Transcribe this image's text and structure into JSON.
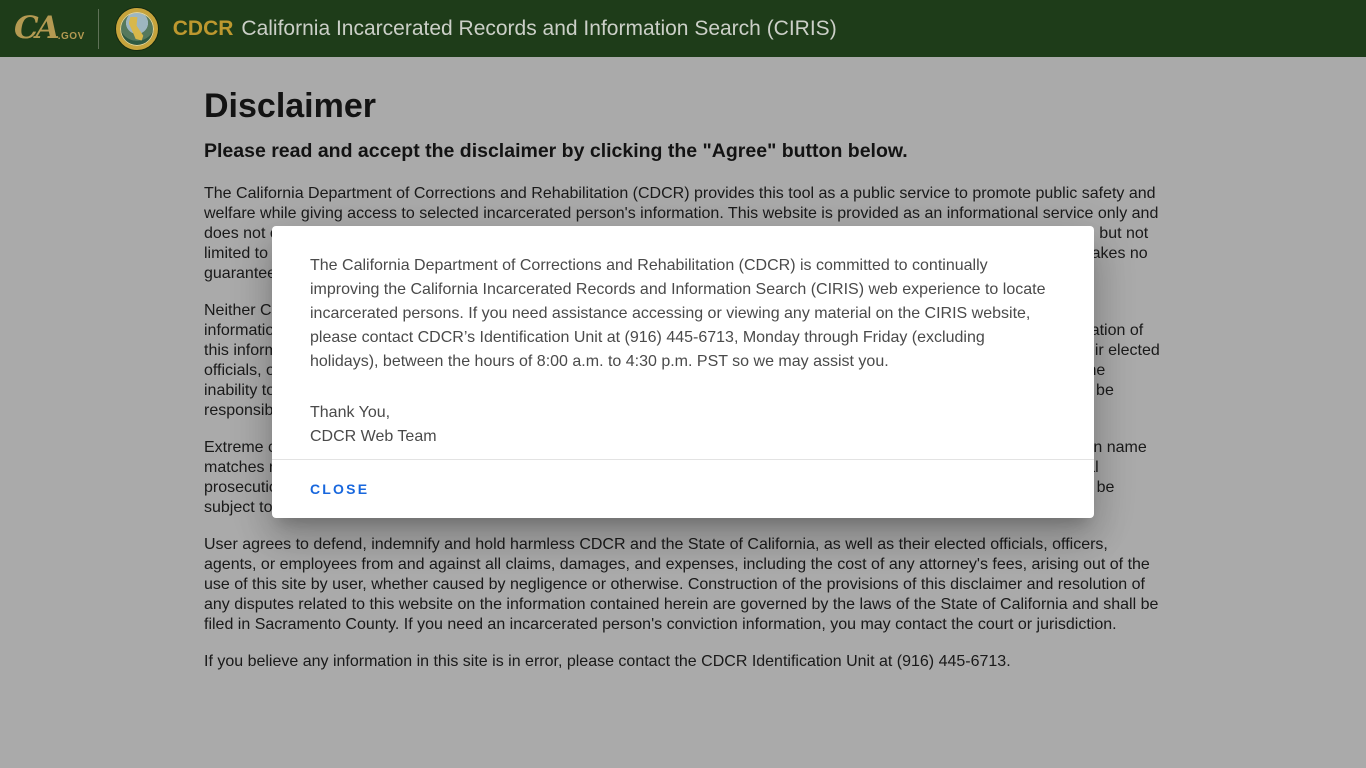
{
  "header": {
    "ca_gov_logo": "CA",
    "ca_gov_suffix": ".GOV",
    "brand_acronym": "CDCR",
    "title": "California Incarcerated Records and Information Search (CIRIS)",
    "colors": {
      "header_bg": "#1e3c19",
      "brand_gold": "#bd982f",
      "title_color": "#cbcfc7"
    }
  },
  "page": {
    "heading": "Disclaimer",
    "subheading": "Please read and accept the disclaimer by clicking the \"Agree\" button below.",
    "paragraphs": [
      "The California Department of Corrections and Rehabilitation (CDCR) provides this tool as a public service to promote public safety and welfare while giving access to selected incarcerated person's information. This website is provided as an informational service only and does not constitute, and should not be relied upon as, an official record of CDCR. It may contain errors or omissions, including but not limited to an incarcerated person's current location, commitment county, admitted date, and scheduled release date. CDCR makes no guarantee as to the accuracy or completeness of the information contained in this website.",
      "Neither CDCR nor the State of California assumes any responsibility or legal liability for the accuracy or completeness of the information contained herein, and the user shall assume full responsibility for any use of this information. Secondary dissemination of this information, by or on consent of the user, may subject the user to liability. CDCR and the State of California, as well as their elected officials, officers, agents, and employees, shall not be liable for any damages of whatever nature arising out of the use of, or the inability to use, this website and the information contained herein. CDCR, the State of California, and any employees shall not be responsible for any errors or omissions in the information contained in this website.",
      "Extreme care should be exercised in the use of the information obtained from this website, as identifications relying solely upon name matches may be inaccurate. Any unauthorized use of the information contained in this website may subject the user to criminal prosecution and/or civil liability.Unauthorized attempts to change the information in this website are strictly prohibited and may be subject to criminal prosecution and/or civil liability.",
      "User agrees to defend, indemnify and hold harmless CDCR and the State of California, as well as their elected officials, officers, agents, or employees from and against all claims, damages, and expenses, including the cost of any attorney's fees, arising out of the use of this site by user, whether caused by negligence or otherwise. Construction of the provisions of this disclaimer and resolution of any disputes related to this website on the information contained herein are governed by the laws of the State of California and shall be filed in Sacramento County. If you need an incarcerated person's conviction information, you may contact the court or jurisdiction.",
      "If you believe any information in this site is in error, please contact the CDCR Identification Unit at (916) 445-6713."
    ]
  },
  "modal": {
    "paragraph": "The California Department of Corrections and Rehabilitation (CDCR) is committed to continually improving the California Incarcerated Records and Information Search (CIRIS) web experience to locate incarcerated persons. If you need assistance accessing or viewing any material on the CIRIS website, please contact CDCR’s Identification Unit at (916) 445-6713, Monday through Friday (excluding holidays), between the hours of 8:00 a.m. to 4:30 p.m. PST so we may assist you.",
    "thanks_line1": "Thank You,",
    "thanks_line2": "CDCR Web Team",
    "close_label": "CLOSE",
    "close_color": "#1867dd"
  }
}
